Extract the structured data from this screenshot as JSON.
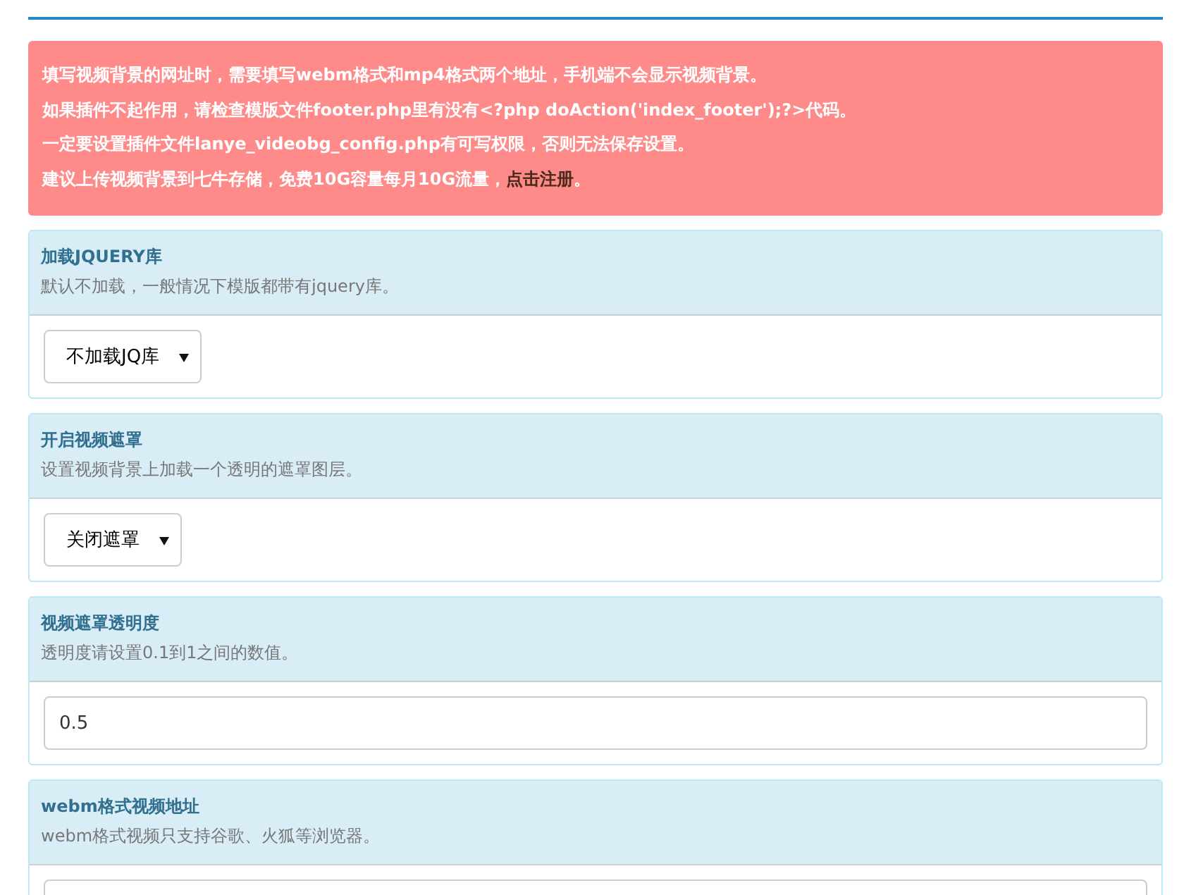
{
  "alert": {
    "lines": [
      {
        "text": "填写视频背景的网址时，需要填写webm格式和mp4格式两个地址，手机端不会显示视频背景。"
      },
      {
        "text": "如果插件不起作用，请检查模版文件footer.php里有没有<?php doAction('index_footer');?>代码。"
      },
      {
        "text": "一定要设置插件文件lanye_videobg_config.php有可写权限，否则无法保存设置。"
      },
      {
        "text": "建议上传视频背景到七牛存储，免费10G容量每月10G流量，",
        "link": "点击注册",
        "after": "。"
      }
    ]
  },
  "panels": [
    {
      "title": "加载JQUERY库",
      "hint": "默认不加载，一般情况下模版都带有jquery库。",
      "kind": "select",
      "value": "不加载JQ库"
    },
    {
      "title": "开启视频遮罩",
      "hint": "设置视频背景上加载一个透明的遮罩图层。",
      "kind": "select",
      "value": "关闭遮罩"
    },
    {
      "title": "视频遮罩透明度",
      "hint": "透明度请设置0.1到1之间的数值。",
      "kind": "input",
      "value": "0.5"
    },
    {
      "title": "webm格式视频地址",
      "hint": "webm格式视频只支持谷歌、火狐等浏览器。",
      "kind": "input"
    }
  ]
}
